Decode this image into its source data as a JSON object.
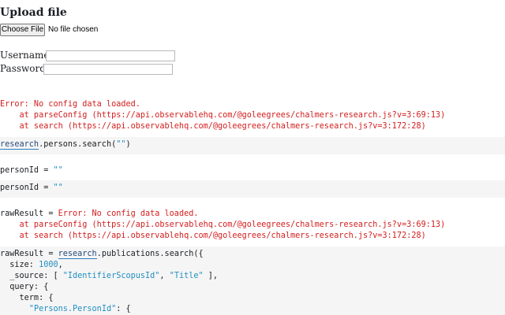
{
  "upload": {
    "title": "Upload file",
    "choose_button": "Choose File",
    "no_file_text": "No file chosen"
  },
  "login": {
    "username_label": "Username:",
    "password_label": "Password:",
    "username_value": "",
    "password_value": ""
  },
  "errors": {
    "message": "Error: No config data loaded.",
    "trace_1": "    at parseConfig (https://api.observablehq.com/@goleegrees/chalmers-research.js?v=3:69:13)",
    "trace_2": "    at search (https://api.observablehq.com/@goleegrees/chalmers-research.js?v=3:172:28)"
  },
  "cells": {
    "persons_search": {
      "ref": "research",
      "rest": ".persons.search(",
      "arg": "\"\"",
      "close": ")"
    },
    "personid_output": {
      "lhs": "personId = ",
      "value": "\"\""
    },
    "personid_input": {
      "lhs": "personId = ",
      "value": "\"\""
    },
    "rawresult_output": {
      "lhs": "rawResult = ",
      "error": "Error: No config data loaded."
    },
    "rawresult_input": {
      "line1_lhs": "rawResult = ",
      "line1_ref": "research",
      "line1_rest": ".publications.search({",
      "line2_key": "  size: ",
      "line2_num": "1000",
      "line2_end": ",",
      "line3_key": "  _source: [ ",
      "line3_s1": "\"IdentifierScopusId\"",
      "line3_sep": ", ",
      "line3_s2": "\"Title\"",
      "line3_end": " ],",
      "line4": "  query: {",
      "line5": "    term: {",
      "line6_str": "\"Persons.PersonId\"",
      "line6_end": ": {"
    }
  },
  "colors": {
    "error": "#d31d1d",
    "string": "#1f8fc1",
    "reference": "#25497a",
    "cell_background": "#f5f5f5"
  }
}
